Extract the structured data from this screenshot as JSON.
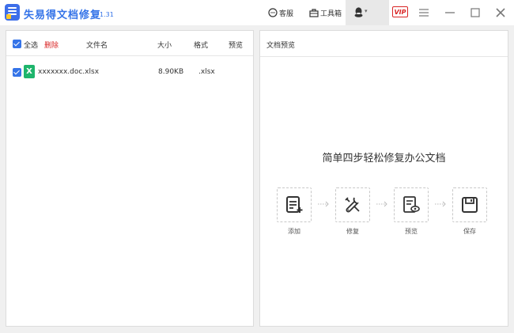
{
  "app": {
    "title": "失易得文档修复",
    "version": "1.31"
  },
  "toolbar": {
    "service_label": "客服",
    "toolbox_label": "工具箱",
    "vip_label": "VIP"
  },
  "file_list": {
    "select_all_label": "全选",
    "delete_label": "删除",
    "columns": [
      "文件名",
      "大小",
      "格式",
      "预览"
    ],
    "rows": [
      {
        "name": "xxxxxxx.doc.xlsx",
        "size": "8.90KB",
        "format": ".xlsx",
        "checked": true,
        "icon": "excel-file-icon"
      }
    ]
  },
  "preview": {
    "title": "文档预览",
    "headline": "简单四步轻松修复办公文档",
    "steps": [
      {
        "label": "添加",
        "icon": "add-document-icon"
      },
      {
        "label": "修复",
        "icon": "repair-tools-icon"
      },
      {
        "label": "预览",
        "icon": "preview-document-icon"
      },
      {
        "label": "保存",
        "icon": "save-icon"
      }
    ]
  },
  "colors": {
    "accent": "#3574e8",
    "danger": "#d92525",
    "excel": "#1eb56c"
  }
}
